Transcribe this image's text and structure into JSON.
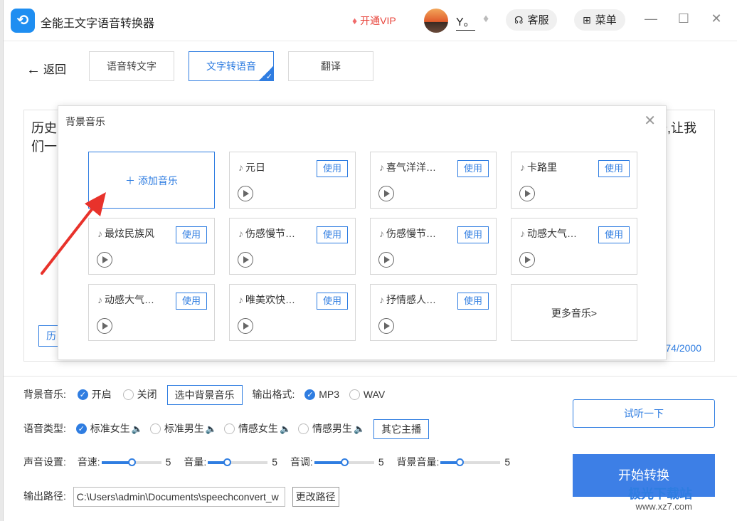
{
  "app": {
    "title": "全能王文字语音转换器",
    "logo": "logo-icon"
  },
  "titlebar": {
    "vip_label": "开通VIP",
    "username": "Y。",
    "service_label": "客服",
    "menu_label": "菜单"
  },
  "nav": {
    "back_label": "返回",
    "tabs": [
      {
        "label": "语音转文字",
        "active": false
      },
      {
        "label": "文字转语音",
        "active": true
      },
      {
        "label": "翻译",
        "active": false
      }
    ]
  },
  "editor": {
    "line1_start": "历史",
    "line1_end": "琦,让我",
    "line2_start": "们一",
    "history_label": "历",
    "char_count": "74/2000"
  },
  "modal": {
    "title": "背景音乐",
    "add_label": "添加音乐",
    "use_label": "使用",
    "more_label": "更多音乐>",
    "tracks": [
      "元日",
      "喜气洋洋…",
      "卡路里",
      "最炫民族风",
      "伤感慢节…",
      "伤感慢节…",
      "动感大气…",
      "动感大气…",
      "唯美欢快…",
      "抒情感人…"
    ]
  },
  "settings": {
    "bg_music_label": "背景音乐:",
    "on_label": "开启",
    "off_label": "关闭",
    "select_bg_label": "选中背景音乐",
    "format_label": "输出格式:",
    "mp3_label": "MP3",
    "wav_label": "WAV",
    "voice_type_label": "语音类型:",
    "voices": [
      "标准女生",
      "标准男生",
      "情感女生",
      "情感男生"
    ],
    "other_anchor_label": "其它主播",
    "sound_label": "声音设置:",
    "speed_label": "音速:",
    "speed_value": "5",
    "volume_label": "音量:",
    "volume_value": "5",
    "pitch_label": "音调:",
    "pitch_value": "5",
    "bg_volume_label": "背景音量:",
    "bg_volume_value": "5",
    "sliders": {
      "speed": 0.5,
      "volume": 0.32,
      "pitch": 0.5,
      "bg_volume": 0.32
    },
    "output_label": "输出路径:",
    "output_path": "C:\\Users\\admin\\Documents\\speechconvert_w",
    "change_path_label": "更改路径",
    "listen_label": "试听一下",
    "start_label": "开始转换"
  },
  "watermark": {
    "main": "极光下载站",
    "sub": "www.xz7.com"
  },
  "colors": {
    "accent": "#2f7de1",
    "vip": "#e8453c"
  }
}
